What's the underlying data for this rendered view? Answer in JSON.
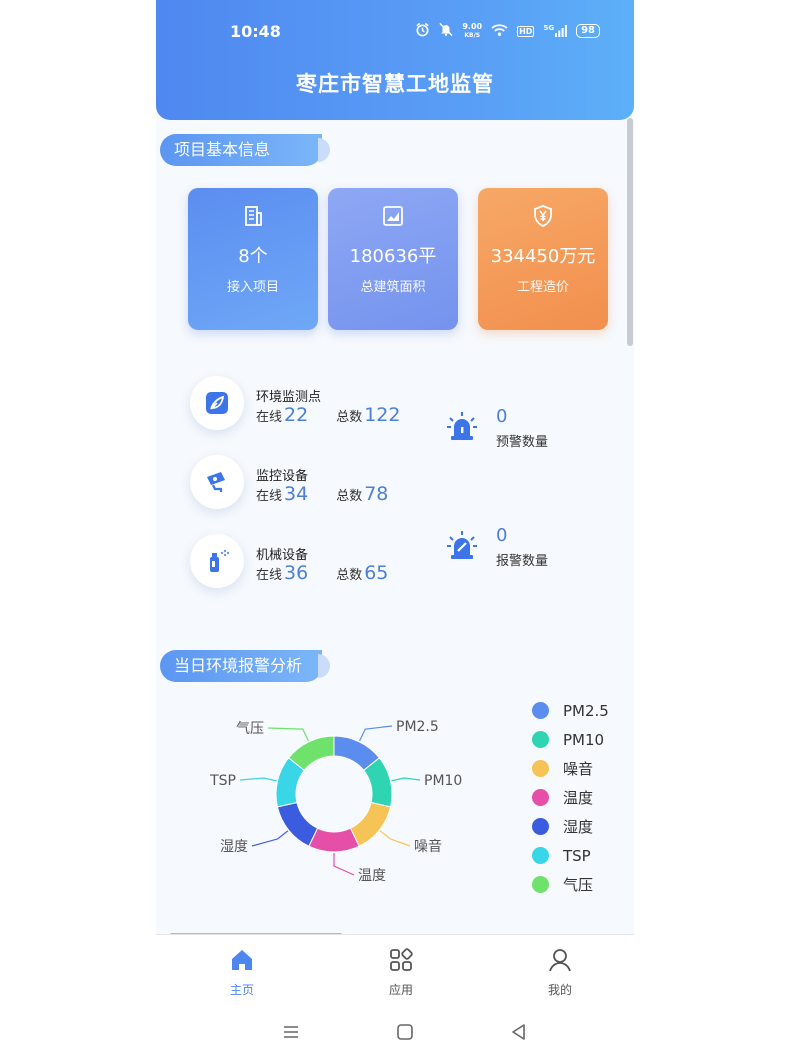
{
  "status_bar": {
    "time": "10:48",
    "net_speed_value": "9.00",
    "net_speed_unit": "KB/S",
    "hd": "HD",
    "signal": "5G",
    "battery": "98"
  },
  "header": {
    "title": "枣庄市智慧工地监管"
  },
  "sections": {
    "basic_info": "项目基本信息",
    "analysis": "当日环境报警分析"
  },
  "cards": [
    {
      "value": "8个",
      "label": "接入项目",
      "icon": "building-icon"
    },
    {
      "value": "180636平",
      "label": "总建筑面积",
      "icon": "area-chart-icon"
    },
    {
      "value": "334450万元",
      "label": "工程造价",
      "icon": "yuan-shield-icon"
    }
  ],
  "devices": [
    {
      "title": "环境监测点",
      "online_label": "在线",
      "online": "22",
      "total_label": "总数",
      "total": "122",
      "icon": "leaf-icon"
    },
    {
      "title": "监控设备",
      "online_label": "在线",
      "online": "34",
      "total_label": "总数",
      "total": "78",
      "icon": "camera-icon"
    },
    {
      "title": "机械设备",
      "online_label": "在线",
      "online": "36",
      "total_label": "总数",
      "total": "65",
      "icon": "spray-icon"
    }
  ],
  "alerts": [
    {
      "value": "0",
      "label": "预警数量",
      "icon": "warning-siren-icon"
    },
    {
      "value": "0",
      "label": "报警数量",
      "icon": "alarm-siren-icon"
    }
  ],
  "chart_data": {
    "type": "pie",
    "donut": true,
    "legend_position": "right",
    "series": [
      {
        "name": "PM2.5",
        "value": 1,
        "color": "#5b8def"
      },
      {
        "name": "PM10",
        "value": 1,
        "color": "#2fd5b3"
      },
      {
        "name": "噪音",
        "value": 1,
        "color": "#f6c356"
      },
      {
        "name": "温度",
        "value": 1,
        "color": "#e64fa8"
      },
      {
        "name": "湿度",
        "value": 1,
        "color": "#3c5ce0"
      },
      {
        "name": "TSP",
        "value": 1,
        "color": "#38d6e6"
      },
      {
        "name": "气压",
        "value": 1,
        "color": "#6ee26a"
      }
    ]
  },
  "bottom_nav": [
    {
      "label": "主页",
      "icon": "home-icon",
      "active": true
    },
    {
      "label": "应用",
      "icon": "apps-icon",
      "active": false
    },
    {
      "label": "我的",
      "icon": "user-icon",
      "active": false
    }
  ],
  "colors": {
    "accent": "#4f88f0",
    "orange": "#f28f4e",
    "number_blue": "#4d7fd6"
  }
}
